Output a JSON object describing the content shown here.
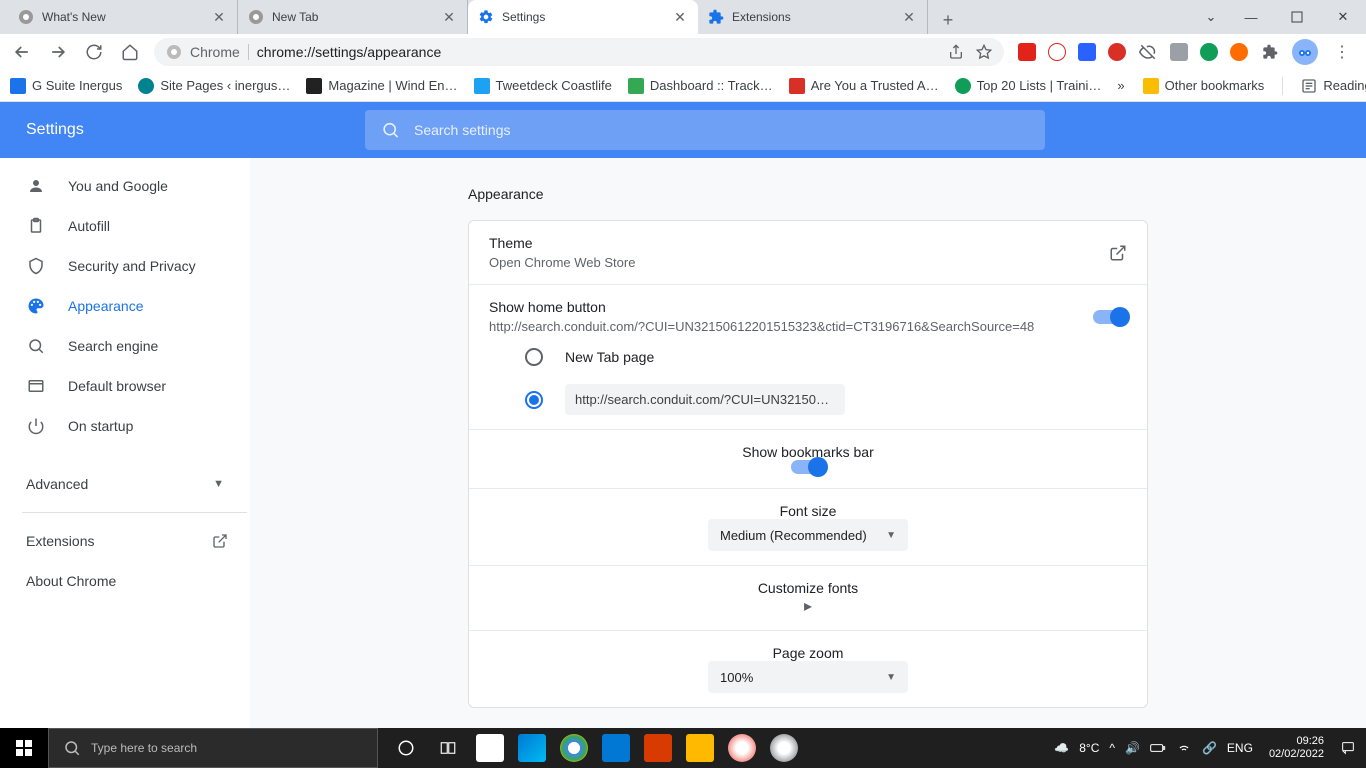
{
  "tabs": [
    {
      "title": "What's New",
      "icon": "chrome"
    },
    {
      "title": "New Tab",
      "icon": "chrome"
    },
    {
      "title": "Settings",
      "icon": "gear",
      "active": true
    },
    {
      "title": "Extensions",
      "icon": "puzzle"
    }
  ],
  "address": {
    "prefix": "Chrome",
    "url": "chrome://settings/appearance"
  },
  "bookmarks": [
    "G Suite Inergus",
    "Site Pages ‹ inergus…",
    "Magazine | Wind En…",
    "Tweetdeck Coastlife",
    "Dashboard :: Track…",
    "Are You a Trusted A…",
    "Top 20 Lists | Traini…"
  ],
  "other_bookmarks": "Other bookmarks",
  "reading_list": "Reading list",
  "header": {
    "title": "Settings",
    "search_placeholder": "Search settings"
  },
  "nav": [
    {
      "label": "You and Google",
      "icon": "person"
    },
    {
      "label": "Autofill",
      "icon": "clipboard"
    },
    {
      "label": "Security and Privacy",
      "icon": "shield"
    },
    {
      "label": "Appearance",
      "icon": "palette",
      "active": true
    },
    {
      "label": "Search engine",
      "icon": "search"
    },
    {
      "label": "Default browser",
      "icon": "browser"
    },
    {
      "label": "On startup",
      "icon": "power"
    }
  ],
  "advanced_label": "Advanced",
  "extensions_label": "Extensions",
  "about_label": "About Chrome",
  "panel": {
    "heading": "Appearance",
    "theme": {
      "title": "Theme",
      "sub": "Open Chrome Web Store"
    },
    "homebutton": {
      "title": "Show home button",
      "sub": "http://search.conduit.com/?CUI=UN32150612201515323&ctid=CT3196716&SearchSource=48",
      "option1": "New Tab page",
      "option2": "http://search.conduit.com/?CUI=UN321506…"
    },
    "bookmarksbar": "Show bookmarks bar",
    "fontsize": {
      "label": "Font size",
      "value": "Medium (Recommended)"
    },
    "customfonts": "Customize fonts",
    "pagezoom": {
      "label": "Page zoom",
      "value": "100%"
    }
  },
  "taskbar": {
    "search_placeholder": "Type here to search",
    "weather": "8°C",
    "lang": "ENG",
    "time": "09:26",
    "date": "02/02/2022"
  }
}
